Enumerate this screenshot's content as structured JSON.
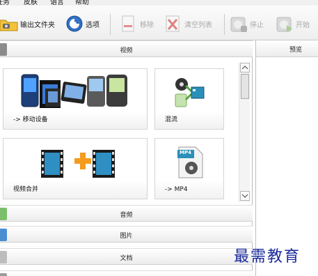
{
  "menu": {
    "items": [
      "任务",
      "皮肤",
      "语言",
      "帮助"
    ]
  },
  "toolbar": {
    "output_folder": "输出文件夹",
    "options": "选项",
    "remove": "移除",
    "clear_list": "清空列表",
    "stop": "停止",
    "start": "开始"
  },
  "categories": {
    "video": "视频",
    "audio": "音频",
    "image": "图片",
    "document": "文档"
  },
  "tiles": [
    {
      "label": "-> 移动设备",
      "icon": "mobile-devices-icon"
    },
    {
      "label": "混流",
      "icon": "mux-icon"
    },
    {
      "label": "视频合并",
      "icon": "video-join-icon"
    },
    {
      "label": "-> MP4",
      "icon": "mp4-file-icon",
      "badge": "MP4"
    }
  ],
  "preview": {
    "title": "预览"
  },
  "watermark": "最需教育",
  "colors": {
    "accent_orange": "#f39c1e",
    "watermark_blue": "#1a2a9a",
    "disabled_text": "#a8a8a8"
  }
}
